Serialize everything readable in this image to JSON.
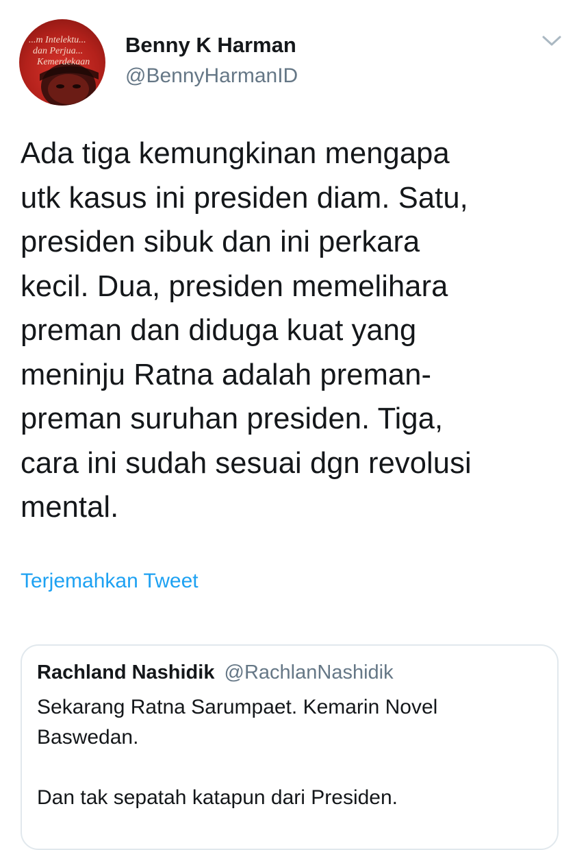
{
  "tweet": {
    "author": {
      "display_name": "Benny K Harman",
      "handle": "@BennyHarmanID",
      "avatar_text": [
        "...m Intelektu...",
        "dan Perjua...",
        "Kemerdekaan"
      ]
    },
    "menu_icon": "chevron-down-icon",
    "text": "Ada tiga kemungkinan mengapa\nutk kasus ini presiden diam. Satu,\npresiden sibuk dan ini perkara\nkecil. Dua, presiden memelihara\npreman dan diduga kuat yang\nmeninju Ratna adalah preman-\npreman suruhan presiden. Tiga,\ncara ini sudah sesuai dgn revolusi\nmental.",
    "translate_label": "Terjemahkan Tweet",
    "quoted_tweet": {
      "display_name": "Rachland Nashidik",
      "handle": "@RachlanNashidik",
      "text": "Sekarang Ratna Sarumpaet. Kemarin Novel\nBaswedan.\n\nDan tak sepatah katapun dari Presiden."
    }
  },
  "colors": {
    "link": "#1da1f2",
    "secondary_text": "#657786",
    "primary_text": "#14171a",
    "border": "#e1e8ed",
    "avatar_red": "#c62a22"
  }
}
